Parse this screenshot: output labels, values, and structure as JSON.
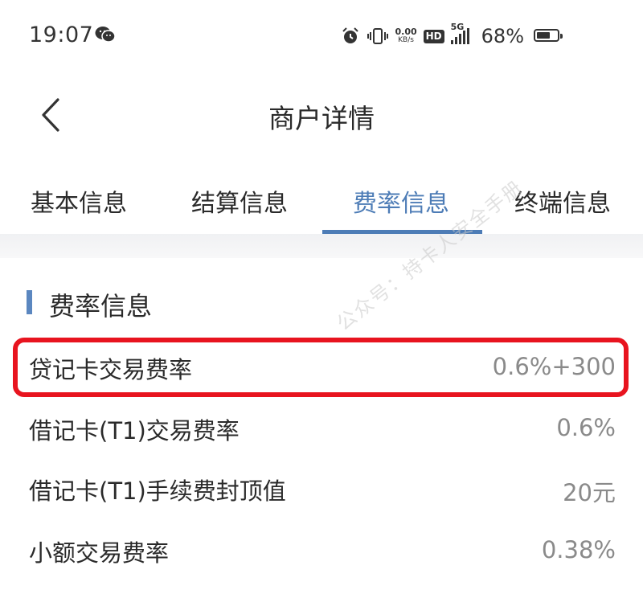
{
  "status_bar": {
    "time": "19:07",
    "net_speed_value": "0.00",
    "net_speed_unit": "KB/s",
    "hd_label": "HD",
    "network_type": "5G",
    "battery_percent": "68%",
    "battery_level": 0.68,
    "icons": [
      "wechat-icon",
      "alarm-icon",
      "vibrate-icon",
      "signal-icon",
      "battery-icon"
    ]
  },
  "header": {
    "title": "商户详情",
    "back_icon": "chevron-left-icon"
  },
  "tabs": [
    {
      "label": "基本信息",
      "active": false
    },
    {
      "label": "结算信息",
      "active": false
    },
    {
      "label": "费率信息",
      "active": true
    },
    {
      "label": "终端信息",
      "active": false
    }
  ],
  "section": {
    "title": "费率信息",
    "rows": [
      {
        "label": "贷记卡交易费率",
        "value": "0.6%+300",
        "highlighted": true
      },
      {
        "label": "借记卡(T1)交易费率",
        "value": "0.6%"
      },
      {
        "label": "借记卡(T1)手续费封顶值",
        "value": "20元"
      },
      {
        "label": "小额交易费率",
        "value": "0.38%"
      }
    ]
  },
  "watermark": "公众号：持卡人安全手册",
  "colors": {
    "accent": "#4d7cb6",
    "highlight_border": "#e8141f",
    "value_text": "#8a8a8a"
  }
}
